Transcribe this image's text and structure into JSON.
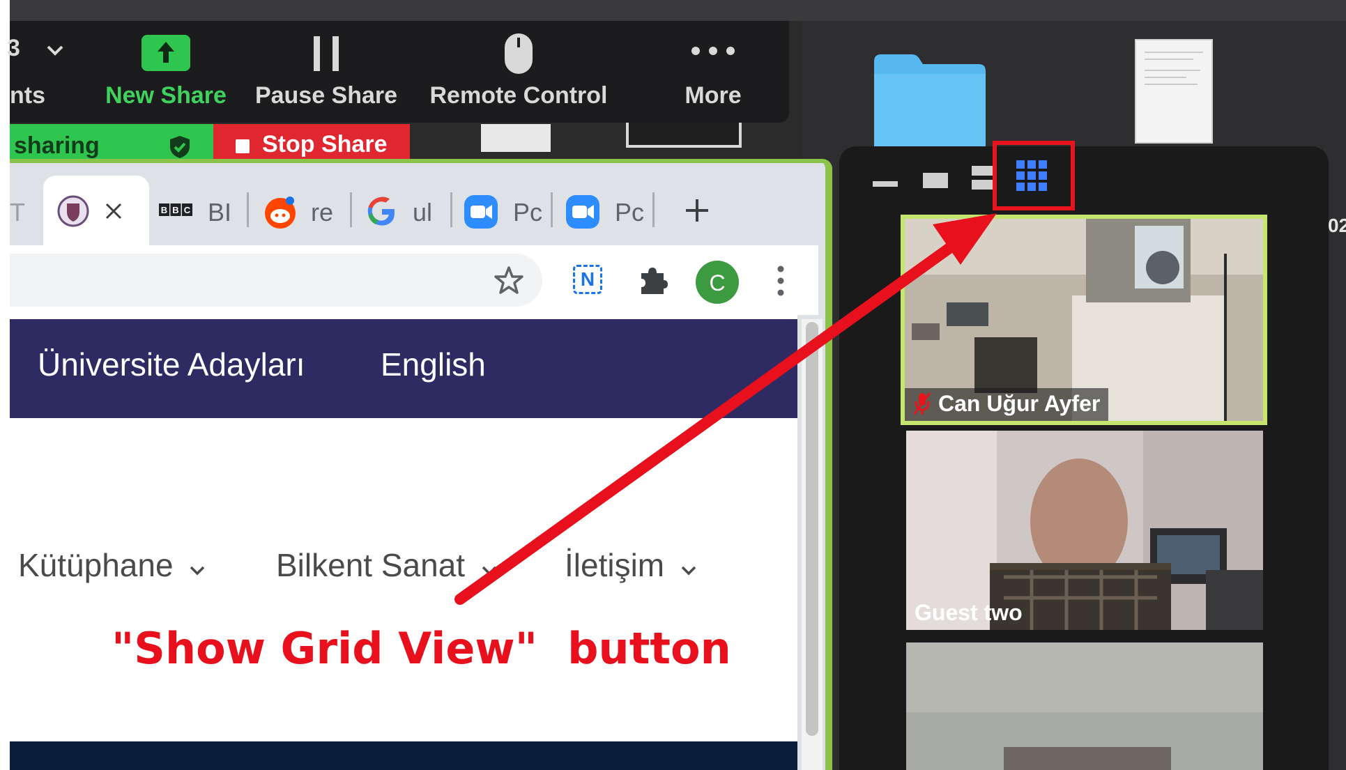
{
  "zoom_toolbar": {
    "partial_item_label": "nts",
    "partial_item_number": "3",
    "new_share_label": "New Share",
    "pause_share_label": "Pause Share",
    "remote_control_label": "Remote Control",
    "more_label": "More"
  },
  "share_status": {
    "status_text": "sharing",
    "stop_share_label": "Stop Share"
  },
  "browser": {
    "tabs": [
      {
        "label": "T",
        "icon": "tab-partial"
      },
      {
        "label": "",
        "icon": "university-crest-icon",
        "active": true
      },
      {
        "label": "BI",
        "icon": "bbc-icon"
      },
      {
        "label": "re",
        "icon": "reddit-icon"
      },
      {
        "label": "ul",
        "icon": "google-icon"
      },
      {
        "label": "Pc",
        "icon": "zoom-icon"
      },
      {
        "label": "Pc",
        "icon": "zoom-icon"
      }
    ],
    "profile_initial": "C",
    "extension_label": "N"
  },
  "page": {
    "top_nav": [
      "Üniversite Adayları",
      "English"
    ],
    "menu": [
      "Kütüphane",
      "Bilkent Sanat",
      "İletişim"
    ]
  },
  "annotation": {
    "text": "\"Show Grid View\"  button",
    "color": "#e8101c"
  },
  "video_panel": {
    "participants": [
      {
        "name": "Can Uğur Ayfer",
        "muted": true,
        "active_speaker": true
      },
      {
        "name": "Guest two",
        "muted": false
      },
      {
        "name": "",
        "muted": false
      }
    ]
  },
  "desktop": {
    "edge_text": "02"
  },
  "colors": {
    "zoom_green": "#2fc64f",
    "stop_red": "#e0262e",
    "nav_purple": "#2e2b63",
    "speaker_border": "#c5e56f",
    "profile_green": "#3c9a40"
  }
}
